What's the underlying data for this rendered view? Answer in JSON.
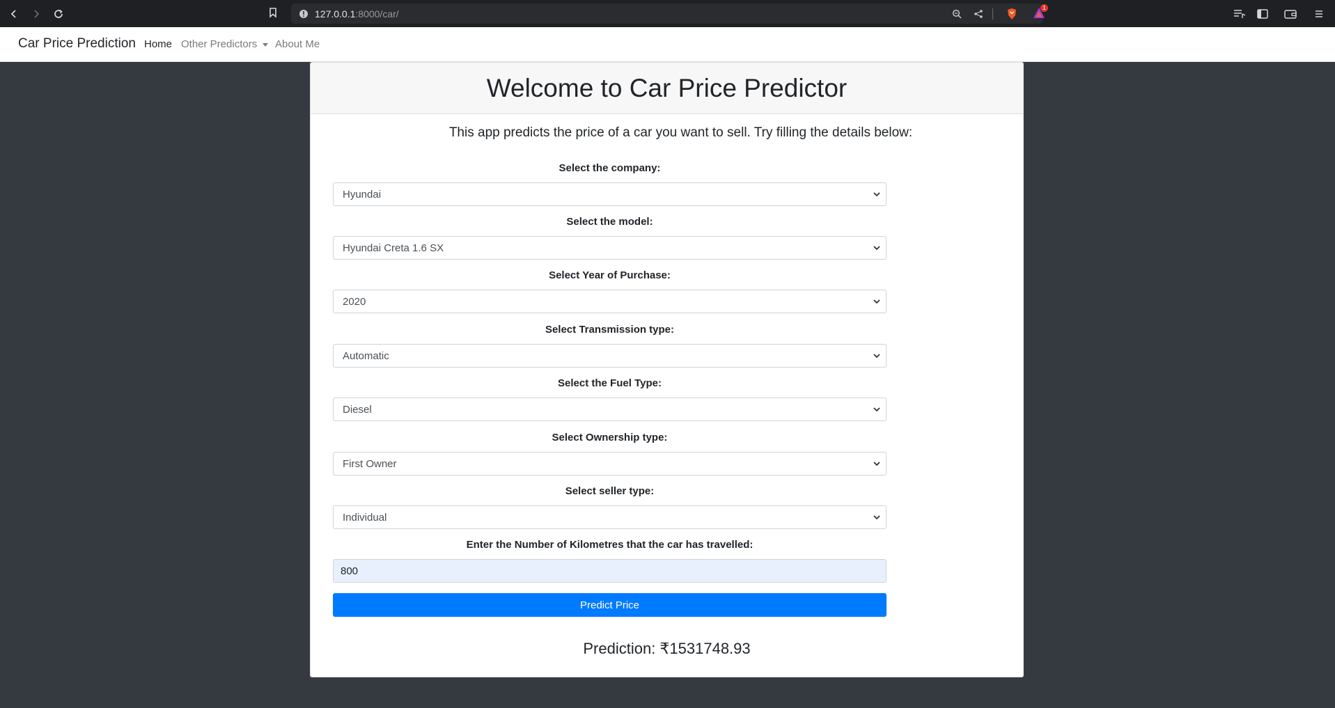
{
  "browser": {
    "url_host": "127.0.0.1",
    "url_rest": ":8000/car/",
    "brave_badge_count": "1"
  },
  "navbar": {
    "brand": "Car Price Prediction",
    "links": [
      {
        "label": "Home"
      },
      {
        "label": "Other Predictors"
      },
      {
        "label": "About Me"
      }
    ]
  },
  "card": {
    "title": "Welcome to Car Price Predictor",
    "intro": "This app predicts the price of a car you want to sell. Try filling the details below:"
  },
  "form": {
    "company": {
      "label": "Select the company:",
      "value": "Hyundai"
    },
    "model": {
      "label": "Select the model:",
      "value": "Hyundai Creta 1.6 SX"
    },
    "year": {
      "label": "Select Year of Purchase:",
      "value": "2020"
    },
    "transmission": {
      "label": "Select Transmission type:",
      "value": "Automatic"
    },
    "fuel": {
      "label": "Select the Fuel Type:",
      "value": "Diesel"
    },
    "ownership": {
      "label": "Select Ownership type:",
      "value": "First Owner"
    },
    "seller": {
      "label": "Select seller type:",
      "value": "Individual"
    },
    "kilometres": {
      "label": "Enter the Number of Kilometres that the car has travelled:",
      "value": "800"
    },
    "submit_label": "Predict Price"
  },
  "result": {
    "text": "Prediction: ₹1531748.93"
  }
}
